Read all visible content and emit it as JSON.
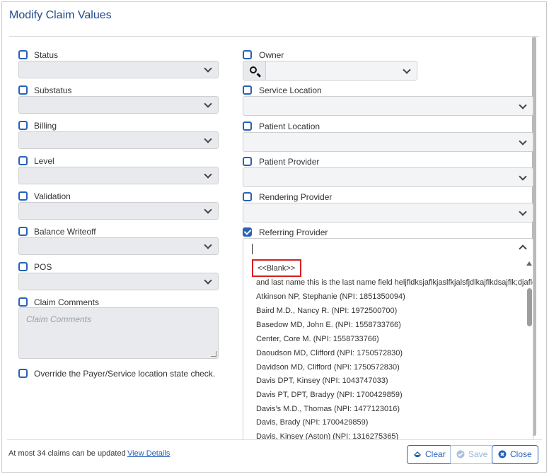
{
  "dialog": {
    "title": "Modify Claim Values"
  },
  "left_fields": [
    {
      "label": "Status"
    },
    {
      "label": "Substatus"
    },
    {
      "label": "Billing"
    },
    {
      "label": "Level"
    },
    {
      "label": "Validation"
    },
    {
      "label": "Balance Writeoff"
    },
    {
      "label": "POS"
    }
  ],
  "claim_comments": {
    "label": "Claim Comments",
    "placeholder": "Claim Comments"
  },
  "override": {
    "label": "Override the Payer/Service location state check."
  },
  "right_fields": [
    {
      "label": "Owner"
    },
    {
      "label": "Service Location"
    },
    {
      "label": "Patient Location"
    },
    {
      "label": "Patient Provider"
    },
    {
      "label": "Rendering Provider"
    },
    {
      "label": "Referring Provider",
      "checked": true
    }
  ],
  "referring_dropdown": {
    "blank": "<<Blank>>",
    "options": [
      "and last name this is the last name field heljfldksjaflkjaslfkjalsfjdlkajflkdsajflk;djafldjal",
      "Atkinson NP, Stephanie (NPI: 1851350094)",
      "Baird M.D., Nancy R. (NPI: 1972500700)",
      "Basedow MD, John E. (NPI: 1558733766)",
      "Center, Core M. (NPI: 1558733766)",
      "Daoudson MD, Clifford (NPI: 1750572830)",
      "Davidson MD, Clifford (NPI: 1750572830)",
      "Davis DPT, Kinsey (NPI: 1043747033)",
      "Davis PT, DPT, Bradyy (NPI: 1700429859)",
      "Davis's M.D., Thomas (NPI: 1477123016)",
      "Davis, Brady (NPI: 1700429859)",
      "Davis, Kinsey (Aston) (NPI: 1316275365)"
    ]
  },
  "footer": {
    "note": "At most 34 claims can be updated",
    "link": "View Details",
    "clear": "Clear",
    "save": "Save",
    "close": "Close"
  },
  "colors": {
    "accent": "#2762b8",
    "highlight": "#d62020"
  }
}
